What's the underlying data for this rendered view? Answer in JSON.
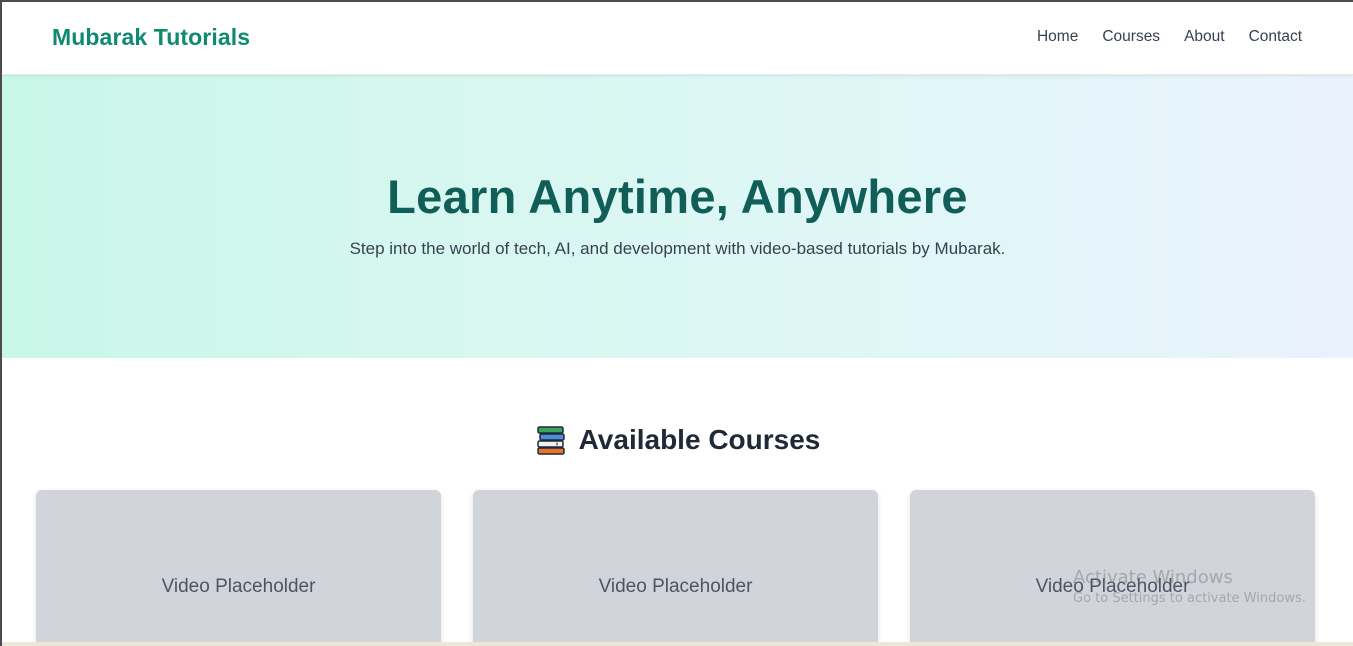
{
  "header": {
    "brand": "Mubarak Tutorials",
    "nav": [
      "Home",
      "Courses",
      "About",
      "Contact"
    ]
  },
  "hero": {
    "title": "Learn Anytime, Anywhere",
    "subtitle": "Step into the world of tech, AI, and development with video-based tutorials by Mubarak."
  },
  "courses": {
    "icon": "books-icon",
    "title": "Available Courses",
    "cards": [
      {
        "label": "Video Placeholder"
      },
      {
        "label": "Video Placeholder"
      },
      {
        "label": "Video Placeholder"
      }
    ]
  },
  "watermark": {
    "title": "Activate Windows",
    "subtitle": "Go to Settings to activate Windows."
  },
  "colors": {
    "brand": "#0f8a72",
    "hero_title": "#115e59",
    "card_bg": "#d1d5db"
  }
}
